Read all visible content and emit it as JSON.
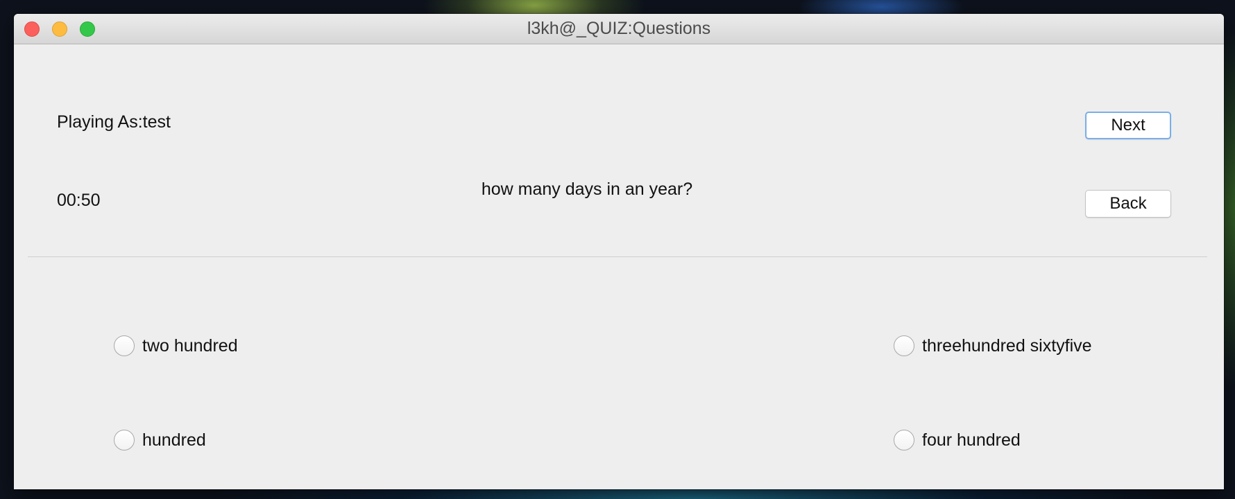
{
  "window": {
    "title": "l3kh@_QUIZ:Questions"
  },
  "header": {
    "player_label": "Playing As:test",
    "timer": "00:50",
    "question": "how many days in an year?"
  },
  "buttons": {
    "next_label": "Next",
    "back_label": "Back"
  },
  "options": [
    {
      "label": "two hundred",
      "selected": false
    },
    {
      "label": "threehundred sixtyfive",
      "selected": false
    },
    {
      "label": "hundred",
      "selected": false
    },
    {
      "label": "four hundred",
      "selected": false
    }
  ],
  "colors": {
    "window_bg": "#eeeeee",
    "close": "#fc605c",
    "minimize": "#fdbc40",
    "zoom": "#34c84a",
    "focus_ring": "#7aaee8"
  }
}
